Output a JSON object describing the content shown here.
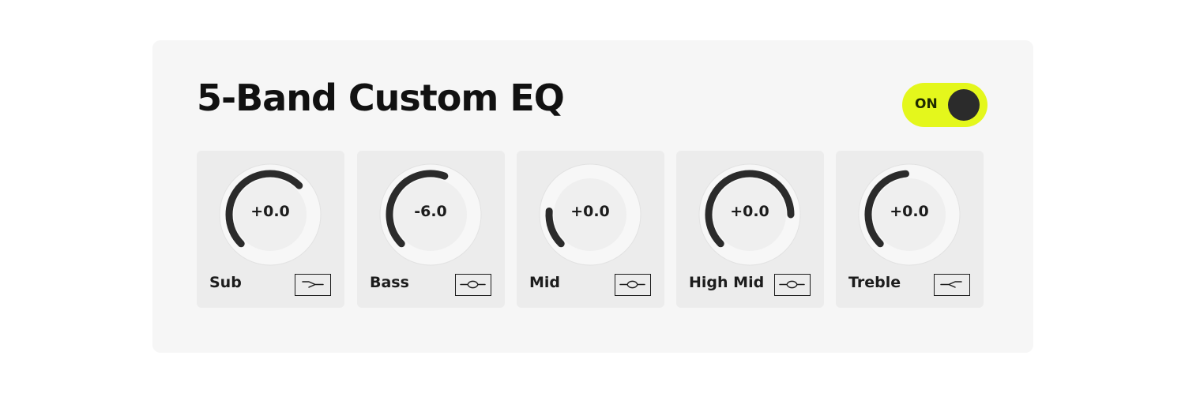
{
  "title": "5-Band Custom EQ",
  "power": {
    "label": "ON",
    "state": "on",
    "accent": "#e4f71c"
  },
  "bands": [
    {
      "label": "Sub",
      "value": "+0.0",
      "arc_start_deg": -135,
      "arc_end_deg": 45,
      "filter_icon": "low-shelf-icon"
    },
    {
      "label": "Bass",
      "value": "-6.0",
      "arc_start_deg": -135,
      "arc_end_deg": 20,
      "filter_icon": "peak-icon"
    },
    {
      "label": "Mid",
      "value": "+0.0",
      "arc_start_deg": -135,
      "arc_end_deg": -85,
      "filter_icon": "peak-icon"
    },
    {
      "label": "High Mid",
      "value": "+0.0",
      "arc_start_deg": -135,
      "arc_end_deg": 90,
      "filter_icon": "peak-icon"
    },
    {
      "label": "Treble",
      "value": "+0.0",
      "arc_start_deg": -135,
      "arc_end_deg": -5,
      "filter_icon": "high-shelf-icon"
    }
  ],
  "colors": {
    "panel": "#f6f6f6",
    "card": "#ececec",
    "arc": "#2b2b2b",
    "text": "#111111"
  }
}
